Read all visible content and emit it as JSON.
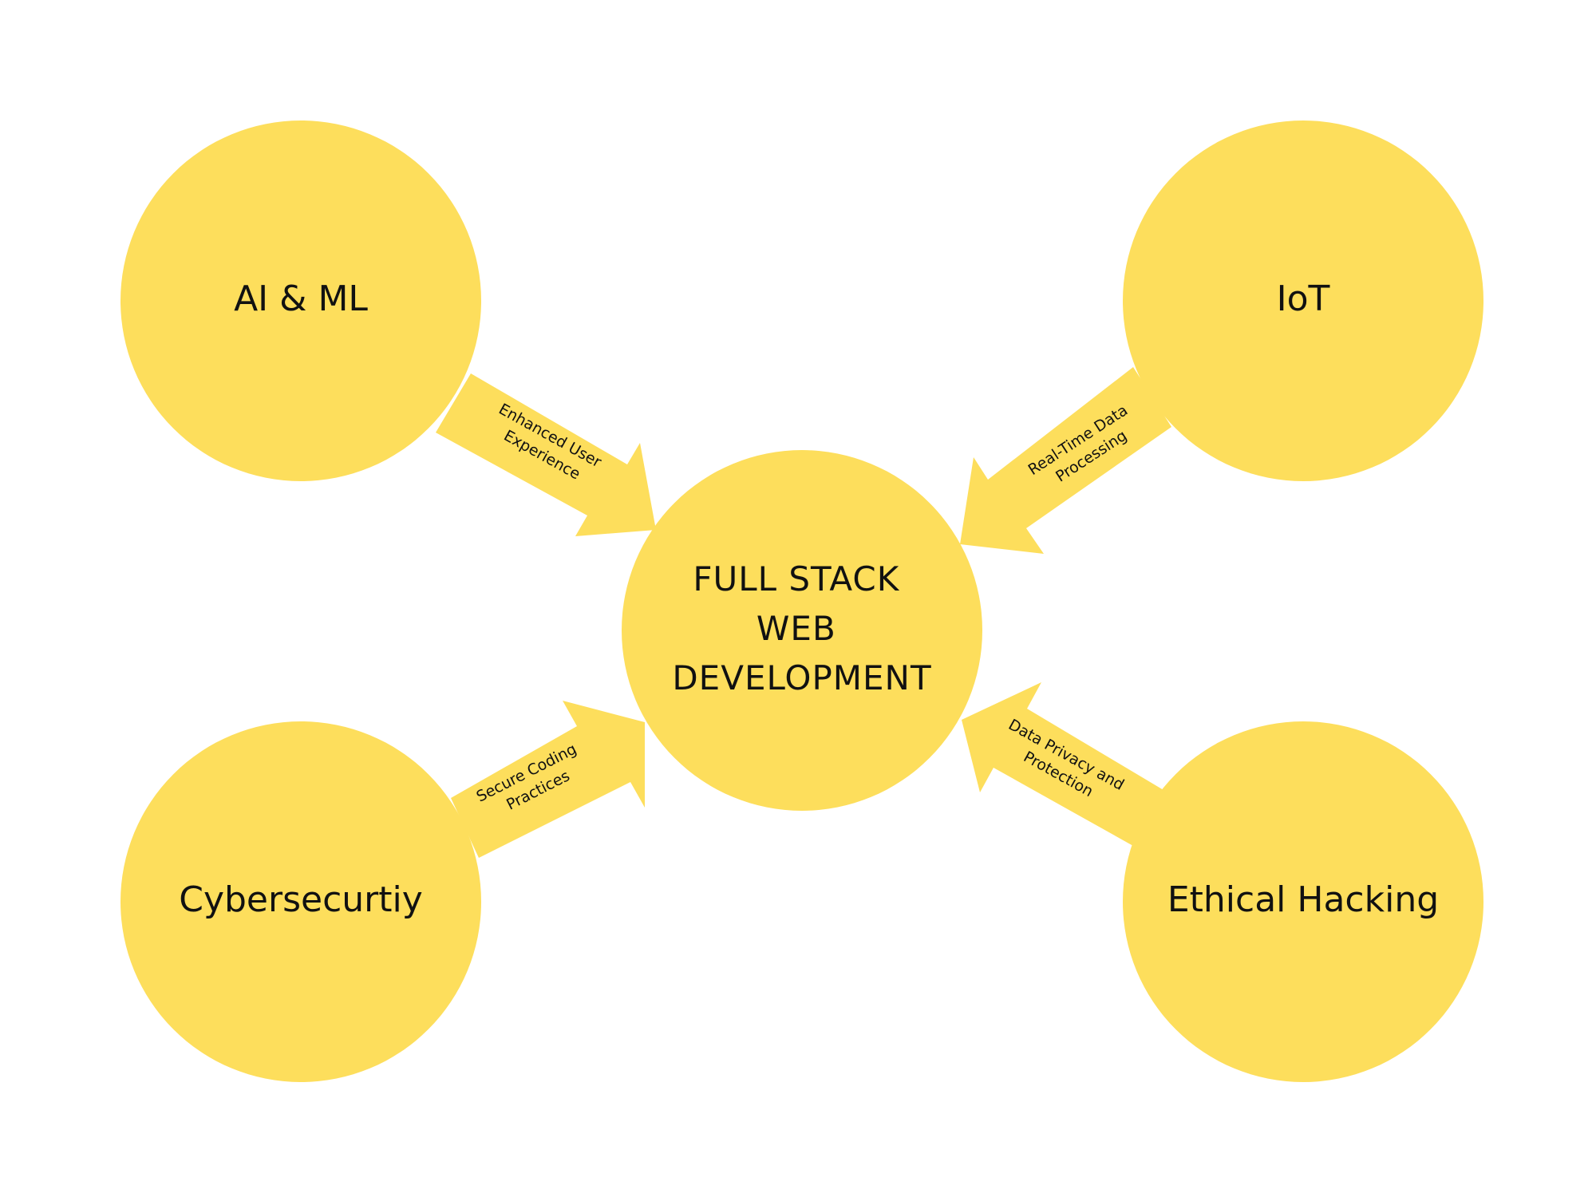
{
  "diagram": {
    "center": {
      "lines": [
        "FULL STACK",
        "WEB",
        "DEVELOPMENT"
      ]
    },
    "nodes": {
      "ai_ml": {
        "label": "AI & ML"
      },
      "iot": {
        "label": "IoT"
      },
      "cyber": {
        "label": "Cybersecurtiy"
      },
      "ethical": {
        "label": "Ethical Hacking"
      }
    },
    "arrows": {
      "ai_ml": {
        "lines": [
          "Enhanced User",
          "Experience"
        ]
      },
      "iot": {
        "lines": [
          "Real-Time Data",
          "Processing"
        ]
      },
      "cyber": {
        "lines": [
          "Secure Coding",
          "Practices"
        ]
      },
      "ethical": {
        "lines": [
          "Data Privacy and",
          "Protection"
        ]
      }
    },
    "colors": {
      "fill": "#FDDE5C",
      "text": "#111111",
      "background": "#FFFFFF"
    }
  }
}
